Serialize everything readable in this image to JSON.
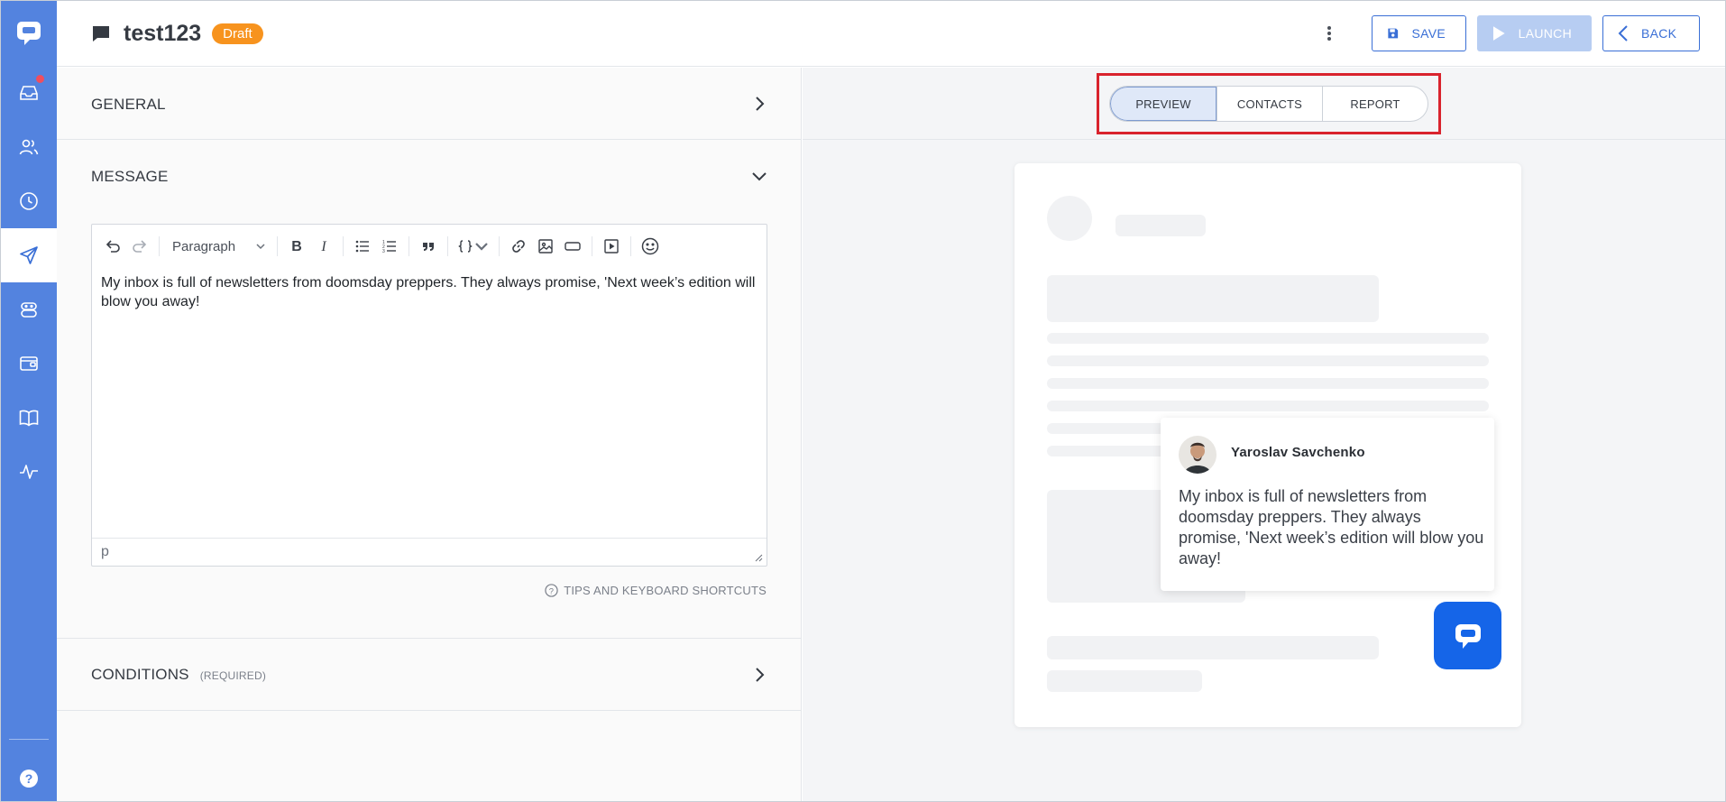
{
  "header": {
    "title": "test123",
    "badge": "Draft",
    "save_label": "SAVE",
    "launch_label": "LAUNCH",
    "back_label": "BACK"
  },
  "sections": {
    "general": "GENERAL",
    "message": "MESSAGE",
    "conditions": "CONDITIONS",
    "conditions_required": "(REQUIRED)"
  },
  "editor": {
    "block_format": "Paragraph",
    "content": "My inbox is full of newsletters from doomsday preppers. They always promise, 'Next week’s edition will blow you away!",
    "status_path": "p",
    "tips_label": "TIPS AND KEYBOARD SHORTCUTS"
  },
  "preview_tabs": [
    {
      "label": "PREVIEW",
      "active": true
    },
    {
      "label": "CONTACTS",
      "active": false
    },
    {
      "label": "REPORT",
      "active": false
    }
  ],
  "preview": {
    "agent_name": "Yaroslav Savchenko",
    "message": "My inbox is full of newsletters from doomsday preppers. They always promise, 'Next week’s edition will blow you away!"
  },
  "sidebar": {
    "items": [
      "logo-icon",
      "inbox-icon",
      "contacts-icon",
      "history-icon",
      "campaigns-icon",
      "bots-icon",
      "wallet-icon",
      "knowledge-base-icon",
      "analytics-icon"
    ],
    "active": "campaigns-icon",
    "notification_dot_on": "inbox-icon"
  },
  "colors": {
    "sidebar": "#5383df",
    "accent": "#3a6fd6",
    "badge": "#f7931e",
    "highlight": "#d9232d",
    "chat_button": "#1565e8"
  }
}
